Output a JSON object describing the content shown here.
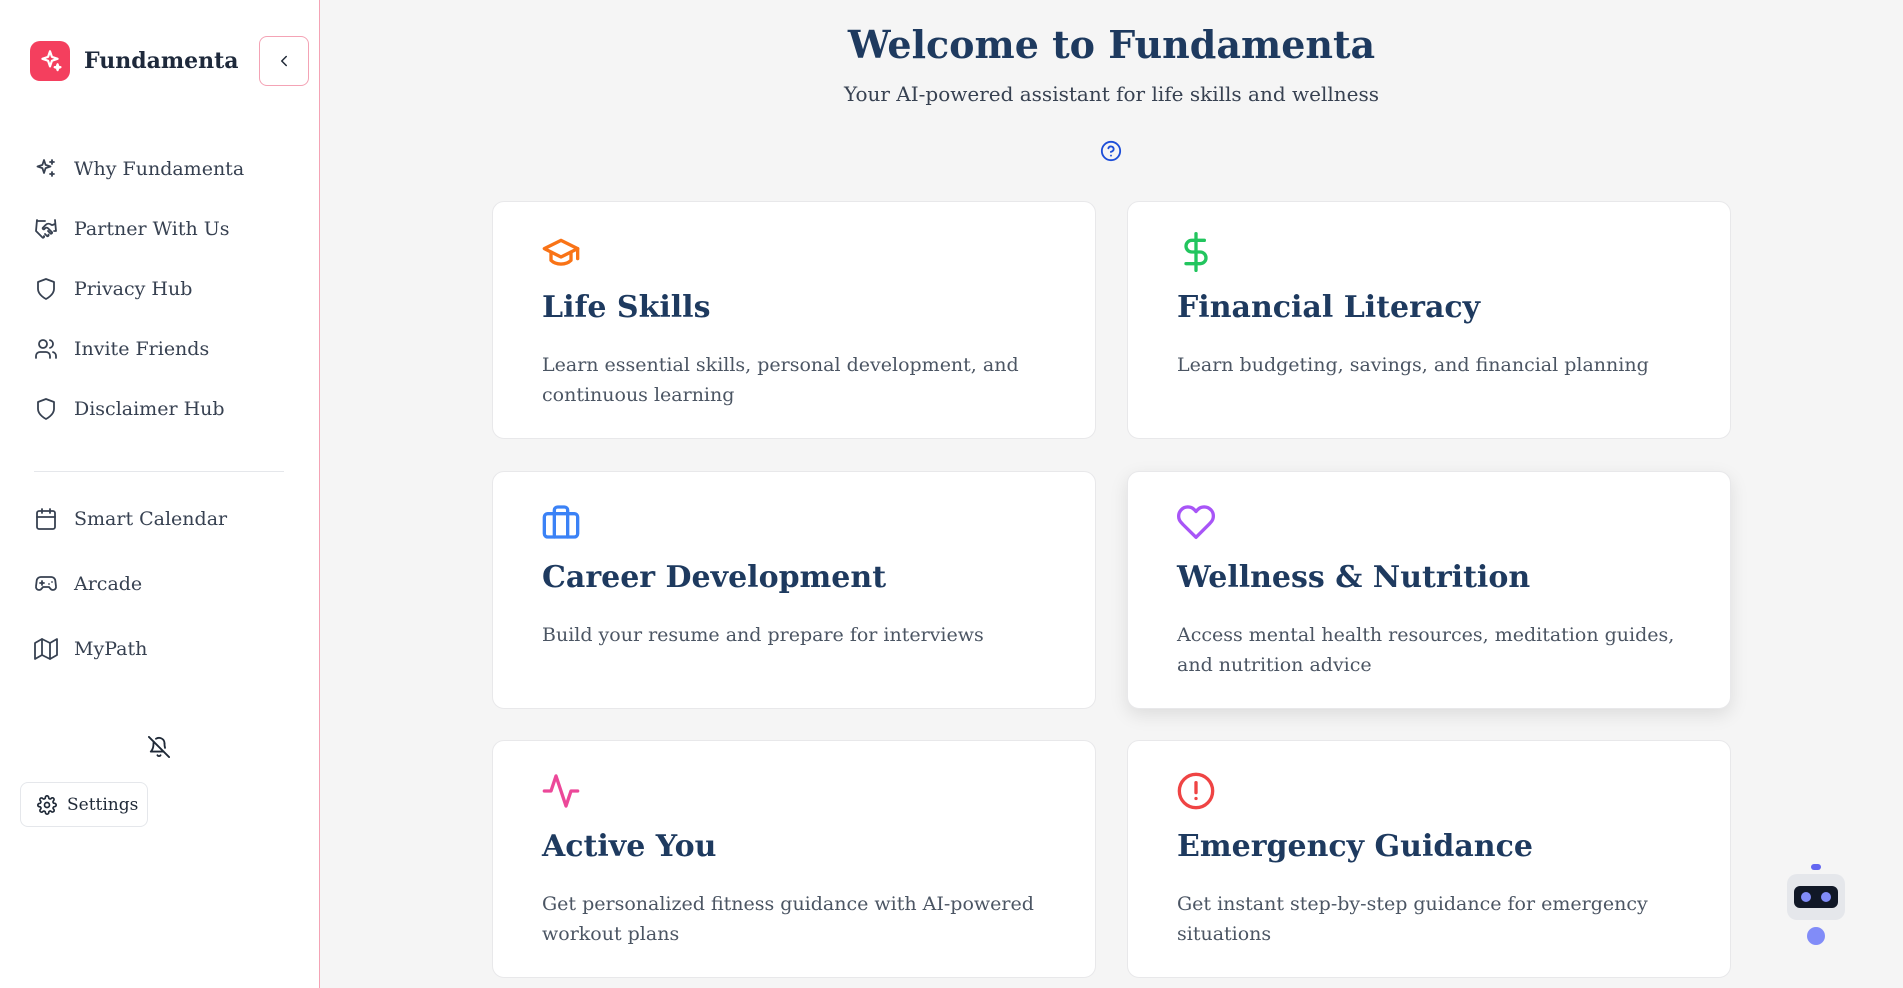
{
  "brand": {
    "name": "Fundamenta",
    "logo_icon": "sparkle-icon",
    "accent": "#f43f5e"
  },
  "sidebar": {
    "collapse_icon": "chevron-left-icon",
    "items_top": [
      {
        "label": "Why Fundamenta",
        "icon": "sparkles-icon"
      },
      {
        "label": "Partner With Us",
        "icon": "handshake-icon"
      },
      {
        "label": "Privacy Hub",
        "icon": "shield-icon"
      },
      {
        "label": "Invite Friends",
        "icon": "users-icon"
      },
      {
        "label": "Disclaimer Hub",
        "icon": "shield-icon"
      }
    ],
    "items_bottom": [
      {
        "label": "Smart Calendar",
        "icon": "calendar-icon"
      },
      {
        "label": "Arcade",
        "icon": "gamepad-icon"
      },
      {
        "label": "MyPath",
        "icon": "map-icon"
      }
    ],
    "notifications_icon": "bell-off-icon",
    "settings_label": "Settings"
  },
  "main": {
    "title": "Welcome to Fundamenta",
    "subtitle": "Your AI-powered assistant for life skills and wellness",
    "help_icon": "help-circle-icon",
    "cards": [
      {
        "title": "Life Skills",
        "description": "Learn essential skills, personal development, and continuous learning",
        "icon": "graduation-cap-icon",
        "color": "#f97316"
      },
      {
        "title": "Financial Literacy",
        "description": "Learn budgeting, savings, and financial planning",
        "icon": "dollar-sign-icon",
        "color": "#22c55e"
      },
      {
        "title": "Career Development",
        "description": "Build your resume and prepare for interviews",
        "icon": "briefcase-icon",
        "color": "#3b82f6"
      },
      {
        "title": "Wellness & Nutrition",
        "description": "Access mental health resources, meditation guides, and nutrition advice",
        "icon": "heart-icon",
        "color": "#a855f7"
      },
      {
        "title": "Active You",
        "description": "Get personalized fitness guidance with AI-powered workout plans",
        "icon": "activity-icon",
        "color": "#ec4899"
      },
      {
        "title": "Emergency Guidance",
        "description": "Get instant step-by-step guidance for emergency situations",
        "icon": "alert-circle-icon",
        "color": "#ef4444"
      }
    ]
  },
  "assistant": {
    "icon": "robot-icon",
    "color": "#6366f1"
  }
}
